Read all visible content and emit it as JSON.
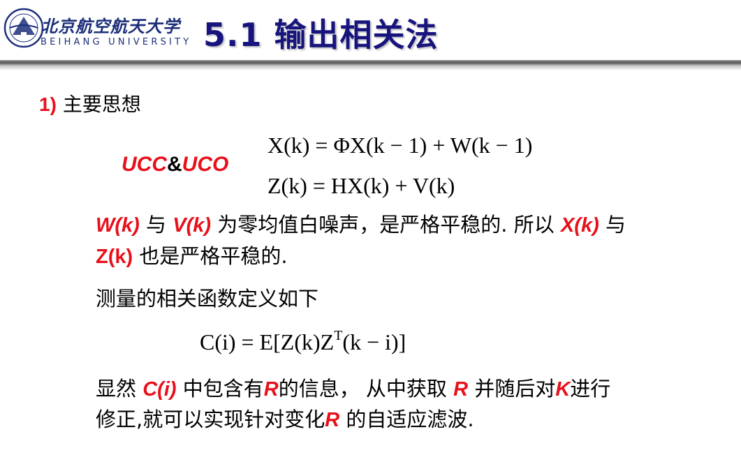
{
  "header": {
    "logo_cn": "北京航空航天大学",
    "logo_en": "BEIHANG UNIVERSITY",
    "title": "5.1 输出相关法"
  },
  "section": {
    "number": "1)",
    "heading": "主要思想"
  },
  "model": {
    "label_ucc": "UCC",
    "label_amp": "&",
    "label_uco": "UCO",
    "eq1": "X(k) = ΦX(k − 1) + W(k − 1)",
    "eq2": "Z(k) = HX(k) + V(k)"
  },
  "para1": {
    "w": "W(k)",
    "t1": " 与 ",
    "v": "V(k)",
    "t2": " 为零均值白噪声，是严格平稳的. 所以 ",
    "x": "X(k)",
    "t3": " 与"
  },
  "para2": {
    "z": "Z(k)",
    "t1": " 也是严格平稳的."
  },
  "para3": "测量的相关函数定义如下",
  "eq3": "C(i) = E[Z(k)Z^T(k − i)]",
  "para4": {
    "t1": "显然 ",
    "c": "C(i)",
    "t2": " 中包含有",
    "r1": "R",
    "t3": "的信息， 从中获取  ",
    "r2": "R",
    "t4": " 并随后对",
    "k": "K",
    "t5": "进行"
  },
  "para5": {
    "t1": "修正,就可以实现针对变化",
    "r": "R",
    "t2": " 的自适应滤波."
  },
  "colors": {
    "title": "#17157d",
    "highlight": "#e8101a",
    "logo": "#1c2f7a"
  }
}
